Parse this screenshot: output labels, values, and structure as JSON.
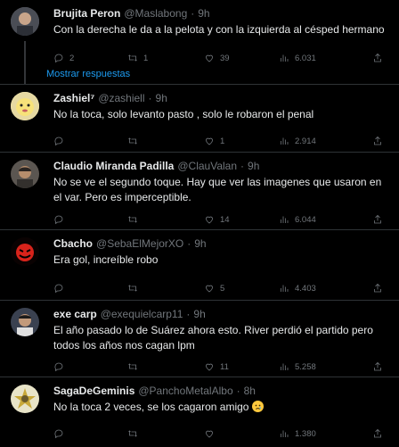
{
  "tweets": [
    {
      "name": "Brujita Peron",
      "handle": "@Maslabong",
      "time": "9h",
      "text": "Con la derecha le da a la pelota y con la izquierda al césped hermano",
      "replies": "2",
      "retweets": "1",
      "likes": "39",
      "views": "6.031"
    },
    {
      "name": "Zashiel⁷",
      "handle": "@zashiell",
      "time": "9h",
      "text": "No la toca, solo levanto pasto  , solo le robaron el penal",
      "replies": "",
      "retweets": "",
      "likes": "1",
      "views": "2.914"
    },
    {
      "name": "Claudio Miranda Padilla",
      "handle": "@ClauValan",
      "time": "9h",
      "text": "No se ve el segundo toque. Hay que ver las imagenes que usaron en el var. Pero es imperceptible.",
      "replies": "",
      "retweets": "",
      "likes": "14",
      "views": "6.044"
    },
    {
      "name": "Cbacho",
      "handle": "@SebaElMejorXO",
      "time": "9h",
      "text": "Era gol, increíble robo",
      "replies": "",
      "retweets": "",
      "likes": "5",
      "views": "4.403"
    },
    {
      "name": "exe carp",
      "handle": "@exequielcarp11",
      "time": "9h",
      "text": "El año pasado lo de Suárez ahora esto. River perdió el partido pero todos los años nos cagan lpm",
      "replies": "",
      "retweets": "",
      "likes": "11",
      "views": "5.258"
    },
    {
      "name": "SagaDeGeminis",
      "handle": "@PanchoMetalAlbo",
      "time": "8h",
      "text": "No la toca 2 veces, se los cagaron amigo",
      "replies": "",
      "retweets": "",
      "likes": "",
      "views": "1.380"
    }
  ],
  "show_replies": "Mostrar respuestas",
  "dot": "·"
}
